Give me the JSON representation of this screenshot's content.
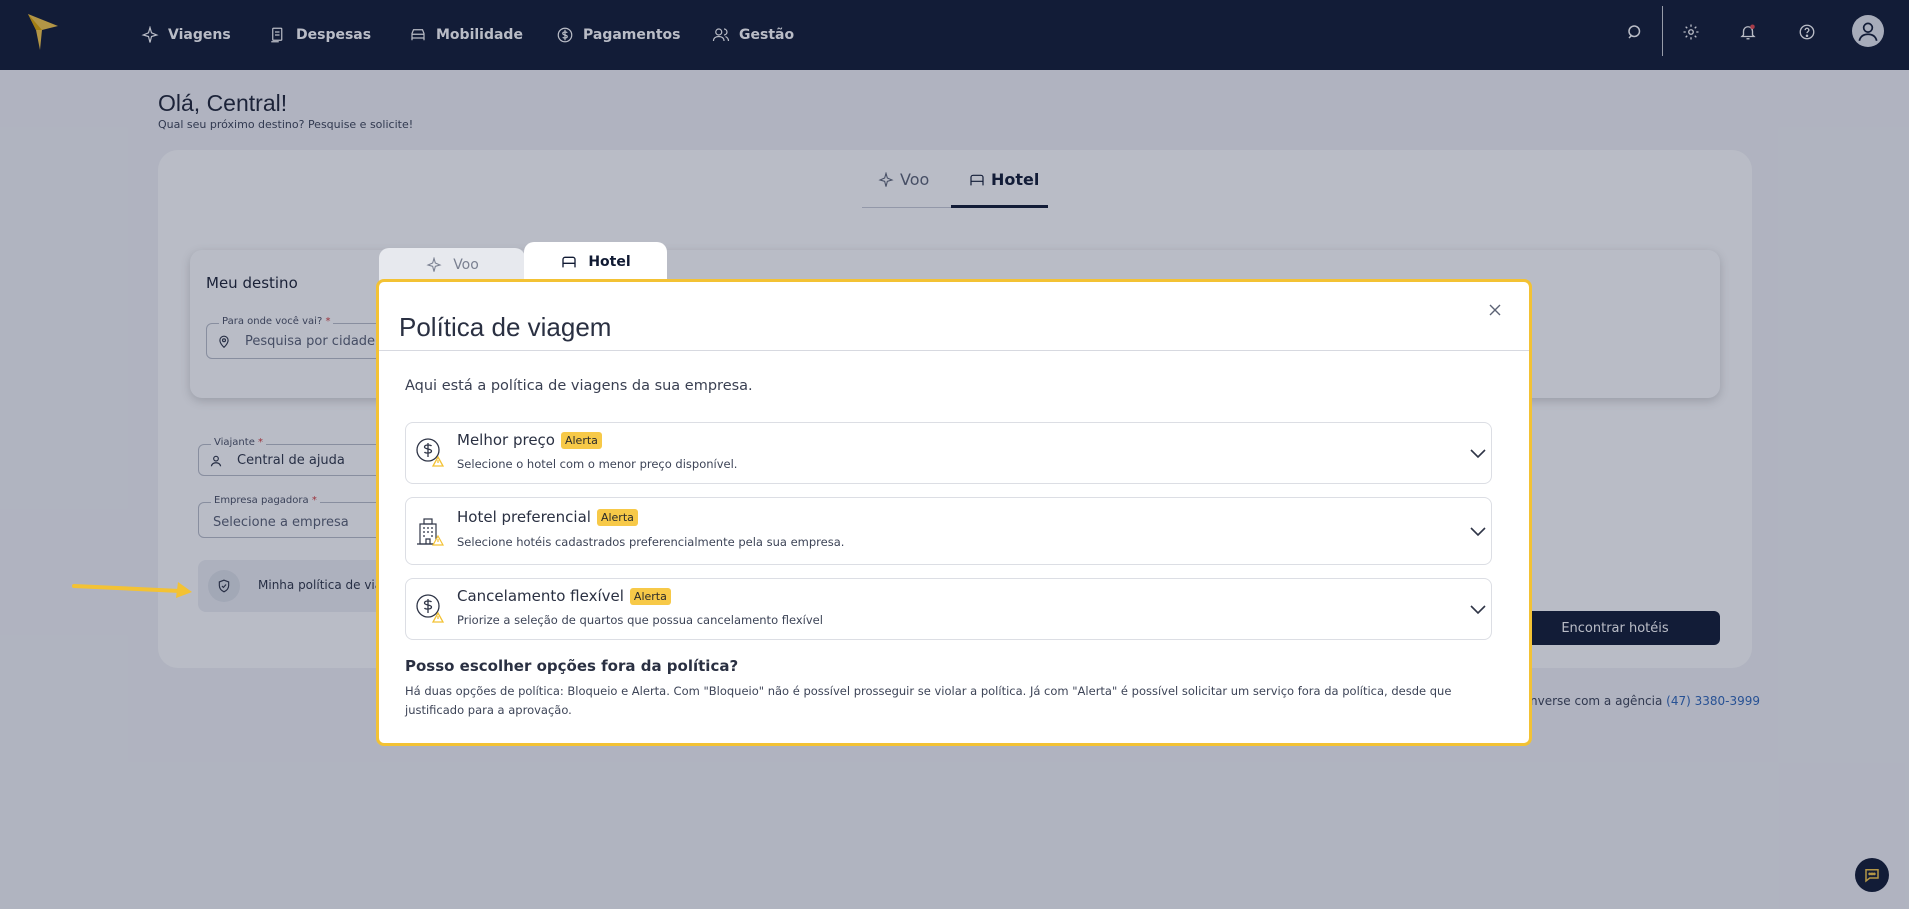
{
  "nav": {
    "items": [
      {
        "label": "Viagens",
        "icon": "plane-icon"
      },
      {
        "label": "Despesas",
        "icon": "receipt-icon"
      },
      {
        "label": "Mobilidade",
        "icon": "car-icon"
      },
      {
        "label": "Pagamentos",
        "icon": "dollar-icon"
      },
      {
        "label": "Gestão",
        "icon": "users-icon"
      }
    ],
    "right_icons": [
      "search-icon",
      "gear-icon",
      "bell-icon",
      "help-icon",
      "avatar"
    ],
    "notification_dot_color": "#e5484d"
  },
  "greeting": {
    "title": "Olá, Central!",
    "subtitle": "Qual seu próximo destino? Pesquise e solicite!"
  },
  "search_tabs": [
    {
      "label": "Voo",
      "active": false
    },
    {
      "label": "Hotel",
      "active": true
    }
  ],
  "form": {
    "dest_label": "Meu destino",
    "dest_field_label": "Para onde você vai?",
    "dest_placeholder": "Pesquisa por cidade, ",
    "traveler_label": "Viajante",
    "traveler_value": "Central de ajuda",
    "company_label": "Empresa pagadora",
    "company_placeholder": "Selecione a empresa",
    "required_mark": "*",
    "policy_link": "Minha política de via",
    "find_button": "Encontrar hotéis",
    "agency_text": "nverse com a agência ",
    "agency_phone": "(47) 3380-3999"
  },
  "modal": {
    "tabs": [
      {
        "label": "Voo",
        "active": false
      },
      {
        "label": "Hotel",
        "active": true
      }
    ],
    "title": "Política de viagem",
    "intro": "Aqui está a política de viagens da sua empresa.",
    "rules": [
      {
        "title": "Melhor preço",
        "badge": "Alerta",
        "desc": "Selecione o hotel com o menor preço disponível.",
        "icon": "dollar-alert-icon"
      },
      {
        "title": "Hotel preferencial",
        "badge": "Alerta",
        "desc": "Selecione hotéis cadastrados preferencialmente pela sua empresa.",
        "icon": "hotel-building-icon"
      },
      {
        "title": "Cancelamento flexível",
        "badge": "Alerta",
        "desc": "Priorize a seleção de quartos que possua cancelamento flexível",
        "icon": "dollar-alert-icon"
      }
    ],
    "faq_question": "Posso escolher opções fora da política?",
    "faq_answer": "Há duas opções de política: Bloqueio e Alerta. Com \"Bloqueio\" não é possível prosseguir se violar a política. Já com \"Alerta\" é possível solicitar um serviço fora da política, desde que justificado para a aprovação."
  },
  "colors": {
    "navy": "#101a33",
    "accent_yellow": "#f3c234",
    "badge_yellow": "#f7c948"
  }
}
